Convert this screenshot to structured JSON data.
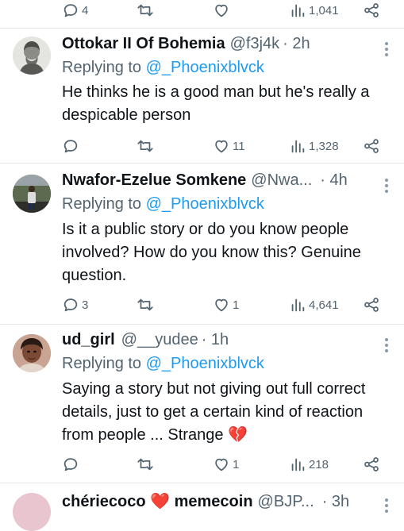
{
  "top_actions": {
    "replies": "4",
    "retweets": "",
    "likes": "",
    "views": "1,041"
  },
  "tweets": [
    {
      "name": "Ottokar II Of Bohemia",
      "handle": "@f3j4k",
      "time": "· 2h",
      "replying_prefix": "Replying to ",
      "replying_to": "@_Phoenixblvck",
      "text": "He thinks he is a good man but he's really a despicable person",
      "replies": "",
      "retweets": "",
      "likes": "11",
      "views": "1,328"
    },
    {
      "name": "Nwafor-Ezelue Somkene",
      "handle": "@Nwa...",
      "time": "· 4h",
      "replying_prefix": "Replying to ",
      "replying_to": "@_Phoenixblvck",
      "text": "Is it a public story or do you know people involved? How do you know this? Genuine question.",
      "replies": "3",
      "retweets": "",
      "likes": "1",
      "views": "4,641"
    },
    {
      "name": "ud_girl",
      "handle": "@__yudee",
      "time": "· 1h",
      "replying_prefix": "Replying to ",
      "replying_to": "@_Phoenixblvck",
      "text": "Saying a story but not giving out full correct details, just to get a certain kind of reaction from people ... Strange 💔",
      "replies": "",
      "retweets": "",
      "likes": "1",
      "views": "218"
    },
    {
      "name": "chériecoco ❤️ memecoin",
      "handle": "@BJP...",
      "time": "· 3h"
    }
  ],
  "colors": {
    "accent": "#1d9bf0",
    "muted": "#536471",
    "text": "#0f1419",
    "broken_heart": "#e0245e"
  },
  "icons": [
    "reply-icon",
    "retweet-icon",
    "like-icon",
    "views-icon",
    "share-icon",
    "more-icon"
  ]
}
